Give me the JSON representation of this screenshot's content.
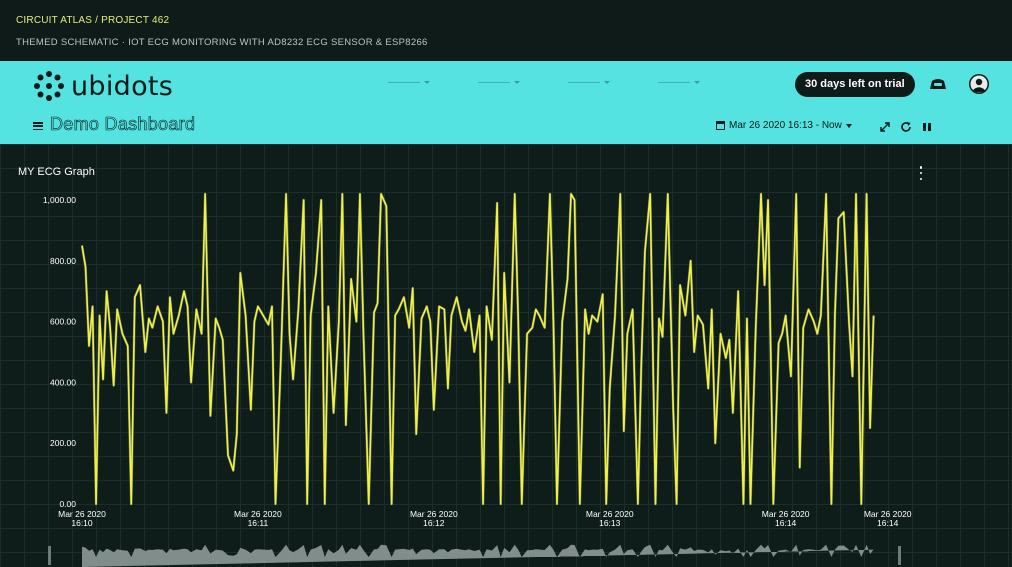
{
  "banner": {
    "breadcrumb": "CIRCUIT ATLAS / PROJECT 462",
    "subtitle": "THEMED SCHEMATIC · IOT ECG MONITORING WITH AD8232 ECG SENSOR & ESP8266"
  },
  "header": {
    "logo_text": "ubidots",
    "trial_label": "30 days left on trial",
    "dashboard_title": "Demo Dashboard",
    "date_range": "Mar 26 2020 16:13 - Now",
    "icons": [
      "menu-icon",
      "calendar-icon",
      "expand-icon",
      "refresh-icon",
      "pause-icon",
      "devices-icon",
      "user-avatar-icon"
    ]
  },
  "widget": {
    "title": "MY ECG Graph"
  },
  "colors": {
    "accent": "#54e3e0",
    "series": "#f2f23a",
    "series_highlight": "#d9e6e0",
    "background": "#0f1d1a"
  },
  "chart_data": {
    "type": "line",
    "ylim": [
      0,
      1000
    ],
    "y_ticks": [
      "0.00",
      "200.00",
      "400.00",
      "600.00",
      "800.00",
      "1,000.00"
    ],
    "x_ticks": [
      {
        "date": "Mar 26 2020",
        "time": "16:10"
      },
      {
        "date": "Mar 26 2020",
        "time": "16:11"
      },
      {
        "date": "Mar 26 2020",
        "time": "16:12"
      },
      {
        "date": "Mar 26 2020",
        "time": "16:13"
      },
      {
        "date": "Mar 26 2020",
        "time": "16:14"
      },
      {
        "date": "Mar 26 2020",
        "time": "16:14"
      }
    ],
    "x_tick_minutes": [
      0,
      1,
      2,
      3,
      4,
      4.58
    ],
    "grid": false,
    "legend": "none",
    "series": [
      {
        "minutes": [
          0.0,
          0.02,
          0.04,
          0.06,
          0.08,
          0.1,
          0.12,
          0.14,
          0.16,
          0.18,
          0.2,
          0.23,
          0.26,
          0.28,
          0.3,
          0.33,
          0.36,
          0.38,
          0.4,
          0.43,
          0.46,
          0.48,
          0.5,
          0.52,
          0.55,
          0.58,
          0.6,
          0.62,
          0.65,
          0.68,
          0.7,
          0.73,
          0.76,
          0.78,
          0.8,
          0.83,
          0.86,
          0.88,
          0.9,
          0.93,
          0.96,
          0.98,
          1.0,
          1.03,
          1.06,
          1.08,
          1.1,
          1.13,
          1.16,
          1.18,
          1.2,
          1.23,
          1.26,
          1.28,
          1.3,
          1.33,
          1.36,
          1.38,
          1.4,
          1.43,
          1.46,
          1.48,
          1.5,
          1.53,
          1.56,
          1.58,
          1.6,
          1.63,
          1.66,
          1.68,
          1.7,
          1.73,
          1.76,
          1.78,
          1.8,
          1.83,
          1.86,
          1.88,
          1.9,
          1.93,
          1.96,
          1.98,
          2.0,
          2.03,
          2.06,
          2.08,
          2.1,
          2.13,
          2.16,
          2.18,
          2.2,
          2.23,
          2.26,
          2.28,
          2.3,
          2.33,
          2.36,
          2.38,
          2.4,
          2.43,
          2.46,
          2.48,
          2.5,
          2.53,
          2.56,
          2.58,
          2.6,
          2.63,
          2.66,
          2.68,
          2.7,
          2.73,
          2.76,
          2.78,
          2.8,
          2.83,
          2.86,
          2.88,
          2.9,
          2.93,
          2.96,
          2.98,
          3.0,
          3.03,
          3.06,
          3.08,
          3.1,
          3.13,
          3.16,
          3.18,
          3.2,
          3.23,
          3.26,
          3.28,
          3.3,
          3.33,
          3.36,
          3.38,
          3.4,
          3.43,
          3.46,
          3.48,
          3.5,
          3.53,
          3.56,
          3.58,
          3.6,
          3.63,
          3.66,
          3.68,
          3.7,
          3.73,
          3.76,
          3.78,
          3.8,
          3.83,
          3.86,
          3.88,
          3.9,
          3.93,
          3.96,
          3.98,
          4.0,
          4.03,
          4.06,
          4.08,
          4.1,
          4.13,
          4.16,
          4.18,
          4.2,
          4.23,
          4.26,
          4.28,
          4.3,
          4.33,
          4.36,
          4.38,
          4.4,
          4.43,
          4.46,
          4.48,
          4.5,
          4.53,
          4.56,
          4.58,
          4.6,
          4.63
        ],
        "values": [
          850,
          780,
          520,
          650,
          0,
          620,
          410,
          700,
          580,
          390,
          640,
          560,
          520,
          0,
          680,
          720,
          500,
          610,
          580,
          650,
          600,
          300,
          680,
          560,
          620,
          700,
          650,
          400,
          640,
          560,
          1020,
          290,
          610,
          580,
          540,
          160,
          110,
          230,
          760,
          620,
          310,
          600,
          650,
          620,
          590,
          650,
          0,
          470,
          1020,
          560,
          410,
          640,
          1000,
          0,
          620,
          760,
          1000,
          0,
          650,
          300,
          600,
          1020,
          260,
          740,
          600,
          1020,
          560,
          0,
          630,
          660,
          1020,
          980,
          0,
          620,
          640,
          680,
          580,
          710,
          230,
          610,
          650,
          600,
          310,
          650,
          640,
          380,
          620,
          680,
          600,
          570,
          640,
          500,
          620,
          0,
          650,
          540,
          990,
          0,
          760,
          400,
          1020,
          600,
          0,
          560,
          580,
          640,
          620,
          580,
          1020,
          600,
          0,
          600,
          740,
          1020,
          1000,
          0,
          640,
          560,
          620,
          600,
          690,
          0,
          380,
          620,
          1020,
          240,
          560,
          640,
          0,
          470,
          830,
          1020,
          0,
          610,
          550,
          1020,
          330,
          0,
          720,
          620,
          800,
          500,
          620,
          590,
          380,
          640,
          200,
          560,
          480,
          540,
          300,
          700,
          0,
          610,
          0,
          580,
          1020,
          720,
          1000,
          0,
          530,
          560,
          620,
          420,
          1020,
          120,
          580,
          640,
          600,
          560,
          620,
          1020,
          0,
          620,
          940,
          960,
          600,
          420,
          1020,
          0,
          1020,
          250,
          620
        ]
      }
    ]
  }
}
